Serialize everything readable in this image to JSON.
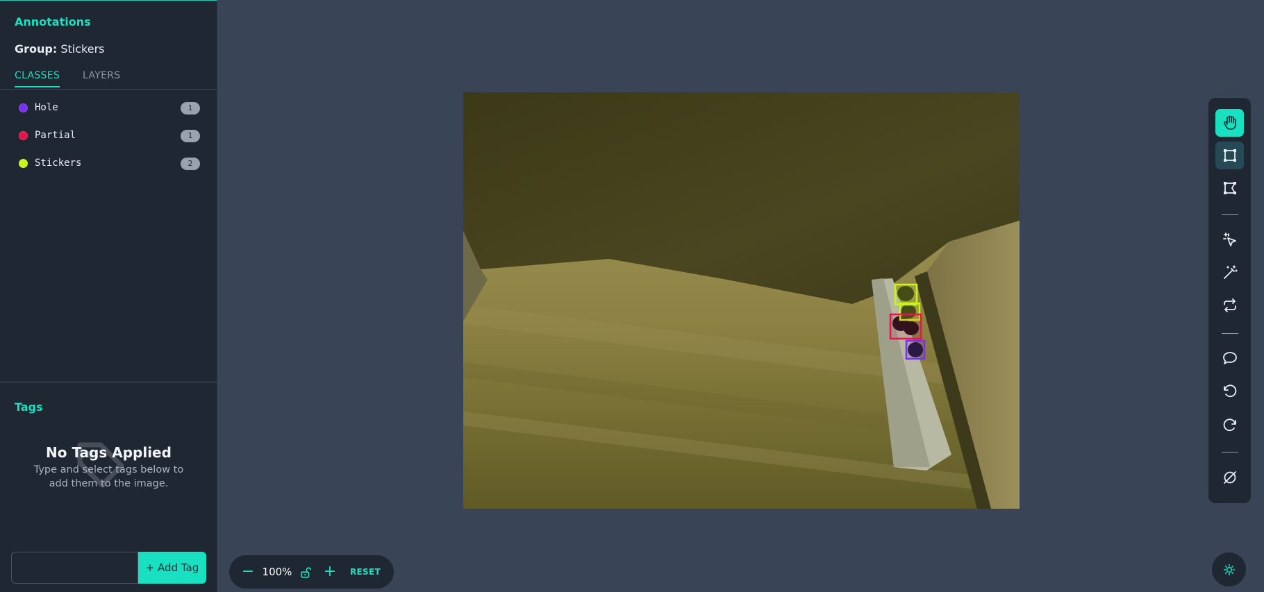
{
  "sidebar": {
    "title": "Annotations",
    "group_label": "Group:",
    "group_value": "Stickers",
    "tabs": [
      {
        "label": "CLASSES",
        "active": true
      },
      {
        "label": "LAYERS",
        "active": false
      }
    ],
    "classes": [
      {
        "name": "Hole",
        "count": "1",
        "color": "#7a2ff5"
      },
      {
        "name": "Partial",
        "count": "1",
        "color": "#e8124f"
      },
      {
        "name": "Stickers",
        "count": "2",
        "color": "#c8f51a"
      }
    ]
  },
  "tags": {
    "title": "Tags",
    "empty_title": "No Tags Applied",
    "empty_desc": "Type and select tags below to add them to the image.",
    "input_value": "",
    "add_button_label": "+ Add Tag"
  },
  "zoom": {
    "minus_label": "−",
    "level": "100%",
    "plus_label": "+",
    "reset_label": "RESET"
  },
  "toolbar": {
    "tools": [
      {
        "name": "hand-tool",
        "icon": "hand-icon",
        "state": "active"
      },
      {
        "name": "bounding-box-tool",
        "icon": "bounding-box-icon",
        "state": "selected"
      },
      {
        "name": "polygon-tool",
        "icon": "polygon-icon",
        "state": "normal"
      },
      {
        "name": "smart-select-tool",
        "icon": "smart-select-icon",
        "state": "normal"
      },
      {
        "name": "magic-wand-tool",
        "icon": "magic-wand-icon",
        "state": "normal"
      },
      {
        "name": "repeat-tool",
        "icon": "repeat-icon",
        "state": "normal"
      },
      {
        "name": "comment-tool",
        "icon": "comment-icon",
        "state": "normal"
      },
      {
        "name": "undo-tool",
        "icon": "undo-icon",
        "state": "normal"
      },
      {
        "name": "redo-tool",
        "icon": "redo-icon",
        "state": "normal"
      },
      {
        "name": "hide-annotations-tool",
        "icon": "hide-icon",
        "state": "normal"
      }
    ]
  },
  "colors": {
    "accent": "#18e0c1",
    "sidebar_bg": "#1f2733",
    "canvas_bg": "#3a4457"
  }
}
